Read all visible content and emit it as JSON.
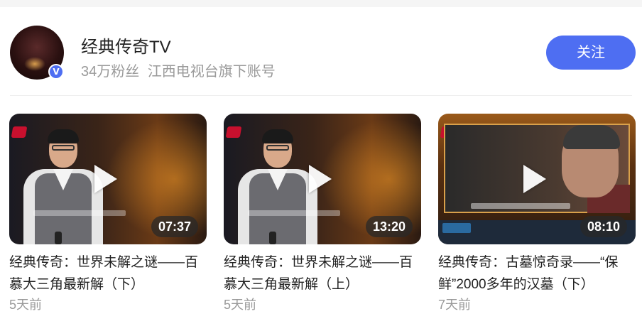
{
  "account": {
    "name": "经典传奇TV",
    "fans": "34万粉丝",
    "description": "江西电视台旗下账号",
    "follow_label": "关注",
    "accent_color": "#4e6ef2"
  },
  "videos": [
    {
      "title": "经典传奇：世界未解之谜——百慕大三角最新解（下）",
      "duration": "07:37",
      "published": "5天前"
    },
    {
      "title": "经典传奇：世界未解之谜——百慕大三角最新解（上）",
      "duration": "13:20",
      "published": "5天前"
    },
    {
      "title": "经典传奇：古墓惊奇录——“保鲜”2000多年的汉墓（下）",
      "duration": "08:10",
      "published": "7天前"
    }
  ]
}
